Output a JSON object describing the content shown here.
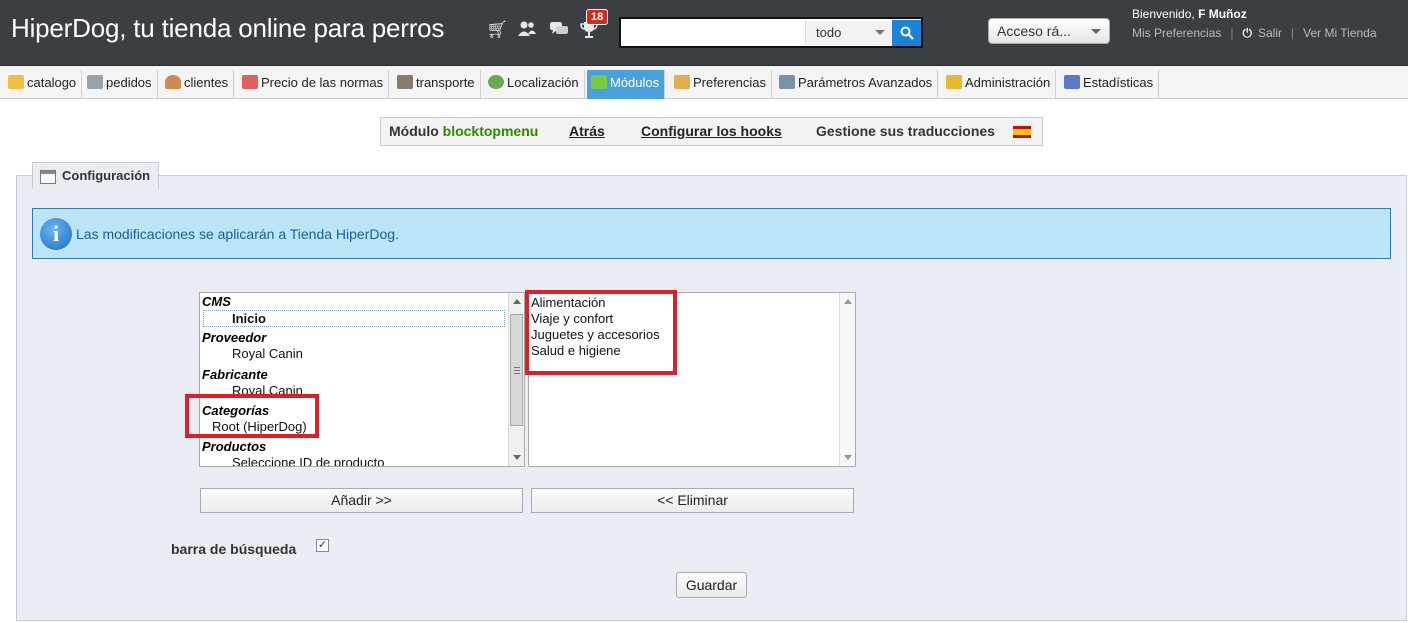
{
  "header": {
    "shop_title": "HiperDog, tu tienda online para perros",
    "notification_count": "18",
    "search": {
      "value": "",
      "scope": "todo"
    },
    "quick_access": "Acceso rá...",
    "welcome_prefix": "Bienvenido,",
    "user_name": "F Muñoz",
    "links": {
      "preferences": "Mis Preferencias",
      "logout": "Salir",
      "view_store": "Ver Mi Tienda"
    }
  },
  "tabs": [
    {
      "label": "catalogo",
      "icon": "folder-icon",
      "color": "#f0c040"
    },
    {
      "label": "pedidos",
      "icon": "cart-icon",
      "color": "#9aa0a8"
    },
    {
      "label": "clientes",
      "icon": "user-icon",
      "color": "#d08a50"
    },
    {
      "label": "Precio de las normas",
      "icon": "price-icon",
      "color": "#e06060"
    },
    {
      "label": "transporte",
      "icon": "truck-icon",
      "color": "#8a7a6a"
    },
    {
      "label": "Localización",
      "icon": "globe-icon",
      "color": "#6aa84f"
    },
    {
      "label": "Módulos",
      "icon": "puzzle-icon",
      "color": "#7ac943",
      "active": true
    },
    {
      "label": "Preferencias",
      "icon": "preferences-icon",
      "color": "#e0b050"
    },
    {
      "label": "Parámetros Avanzados",
      "icon": "wrench-icon",
      "color": "#7a8fa8"
    },
    {
      "label": "Administración",
      "icon": "key-icon",
      "color": "#e8b830"
    },
    {
      "label": "Estadísticas",
      "icon": "chart-icon",
      "color": "#5a7ac8"
    }
  ],
  "toolbar": {
    "module_prefix": "Módulo",
    "module_name": "blocktopmenu",
    "back": "Atrás",
    "configure_hooks": "Configurar los hooks",
    "translations": "Gestione sus traducciones"
  },
  "config": {
    "legend": "Configuración",
    "info": "Las modificaciones se aplicarán a Tienda HiperDog.",
    "available": {
      "cms_group": "CMS",
      "cms_home": "Inicio",
      "supplier_group": "Proveedor",
      "supplier_item": "Royal Canin",
      "manufacturer_group": "Fabricante",
      "manufacturer_item": "Royal Canin",
      "categories_group": "Categorías",
      "categories_root": "Root (HiperDog)",
      "products_group": "Productos",
      "products_item": "Seleccione ID de producto"
    },
    "selected": [
      "Alimentación",
      "Viaje y confort",
      "Juguetes y accesorios",
      "Salud e higiene"
    ],
    "add_button": "Añadir >>",
    "remove_button": "<< Eliminar",
    "search_bar_label": "barra de búsqueda",
    "search_bar_checked": true,
    "save_button": "Guardar"
  }
}
